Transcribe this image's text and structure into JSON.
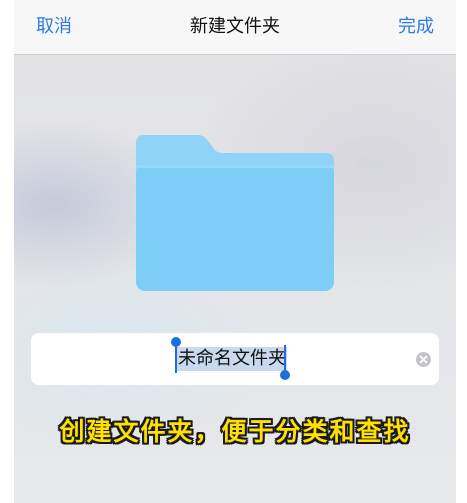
{
  "nav": {
    "cancel_label": "取消",
    "title": "新建文件夹",
    "done_label": "完成"
  },
  "folder": {
    "icon": "folder-icon",
    "color_tab": "#8fd3f9",
    "color_front": "#7ecdf7"
  },
  "name_field": {
    "value": "未命名文件夹",
    "selected": true,
    "clear_icon": "clear-circle-icon"
  },
  "caption": {
    "text": "创建文件夹，便于分类和查找"
  },
  "colors": {
    "accent": "#2d7be2",
    "selection": "#c9d9ef",
    "handle": "#1d6fe0",
    "caption_fill": "#ffe000"
  }
}
